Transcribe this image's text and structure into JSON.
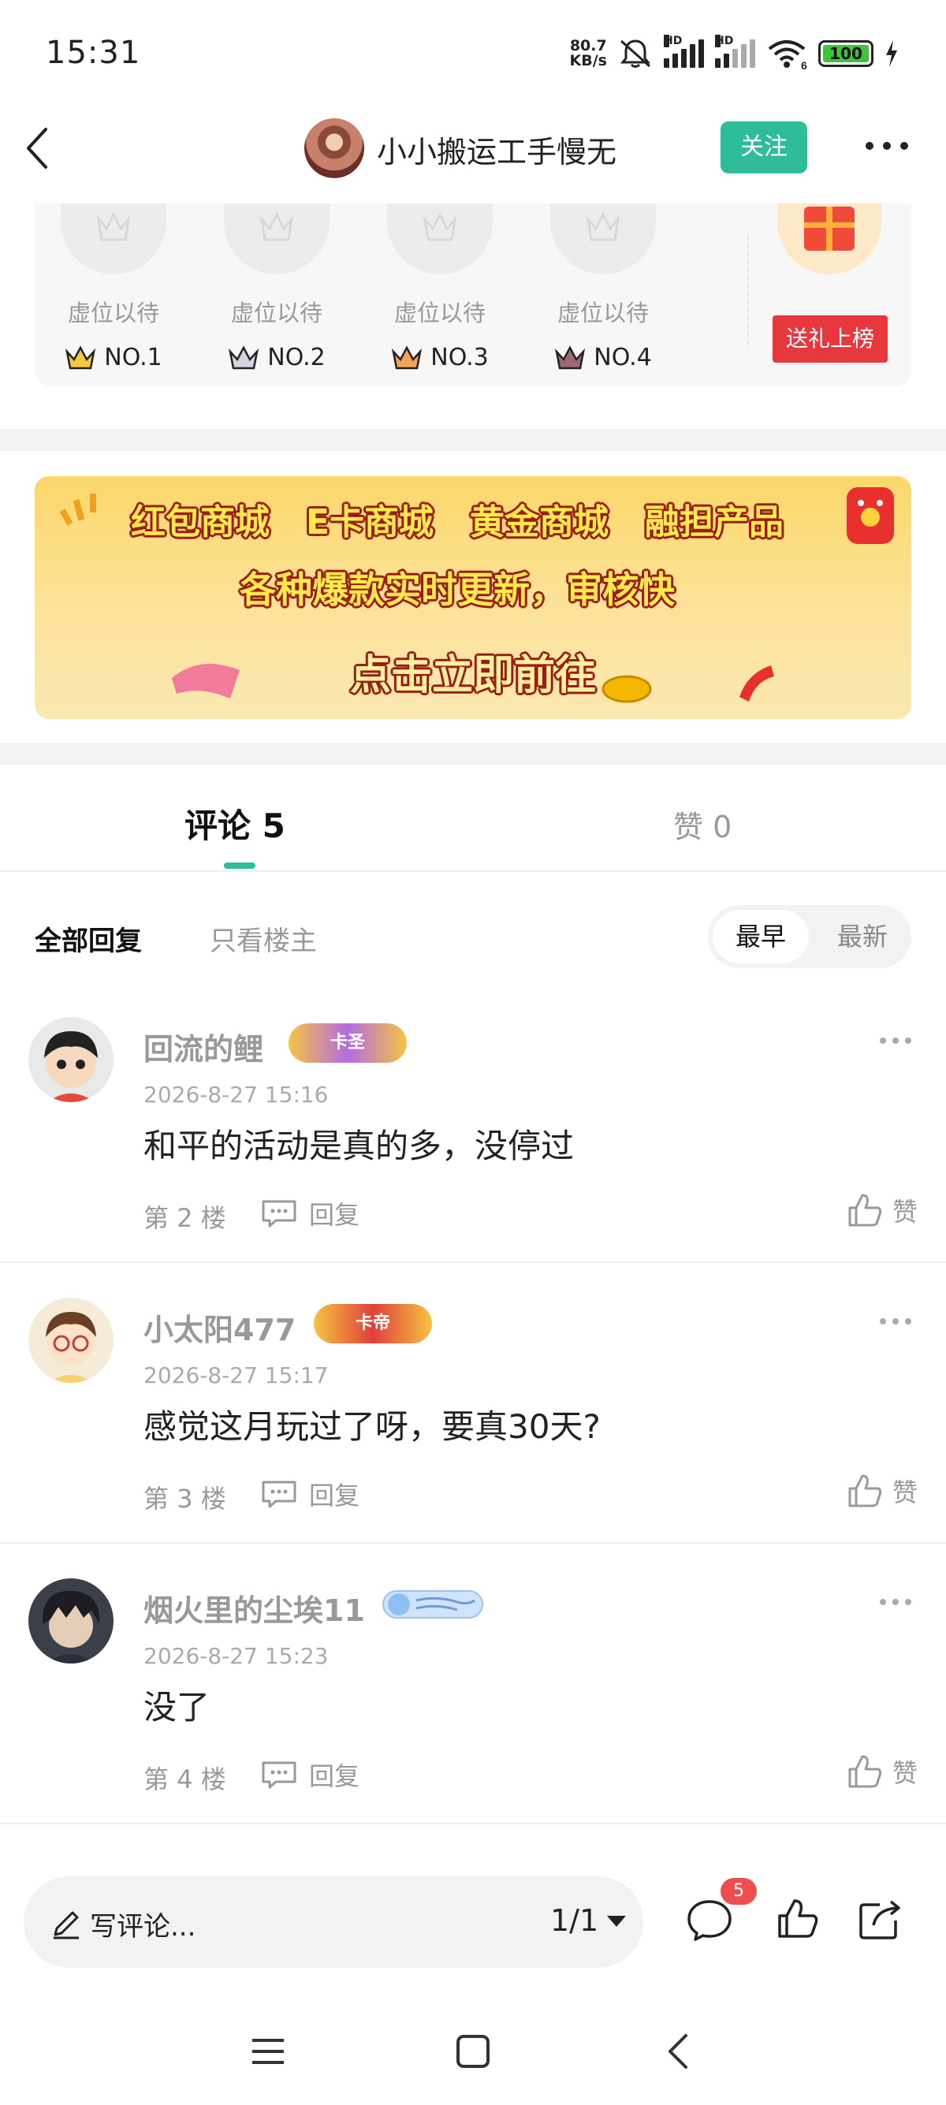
{
  "status_bar": {
    "time": "15:31",
    "net_speed_value": "80.7",
    "net_speed_unit": "KB/s",
    "hd1": "HD",
    "hd2": "HD",
    "wifi_gen": "6",
    "battery": "100"
  },
  "nav": {
    "title": "小小搬运工手慢无",
    "follow_label": "关注"
  },
  "ranking": {
    "slots": [
      {
        "label": "虚位以待",
        "rank": "NO.1",
        "crown_color": "#e9b420"
      },
      {
        "label": "虚位以待",
        "rank": "NO.2",
        "crown_color": "#b9b9c6"
      },
      {
        "label": "虚位以待",
        "rank": "NO.3",
        "crown_color": "#e08a3c"
      },
      {
        "label": "虚位以待",
        "rank": "NO.4",
        "crown_color": "#8a5a66"
      }
    ],
    "gift_button": "送礼上榜"
  },
  "banner": {
    "items": [
      "红包商城",
      "E卡商城",
      "黄金商城",
      "融担产品"
    ],
    "subtitle": "各种爆款实时更新，审核快",
    "cta": "点击立即前往"
  },
  "tabs": {
    "comments_label": "评论 5",
    "likes_label": "赞 0"
  },
  "filters": {
    "all": "全部回复",
    "op_only": "只看楼主",
    "sort_earliest": "最早",
    "sort_latest": "最新"
  },
  "comments": [
    {
      "name": "回流的鲤",
      "badge": "卡圣",
      "time": "2026-8-27 15:16",
      "text": "和平的活动是真的多，没停过",
      "floor": "第 2 楼",
      "reply": "回复",
      "like": "赞"
    },
    {
      "name": "小太阳477",
      "badge": "卡帝",
      "time": "2026-8-27 15:17",
      "text": "感觉这月玩过了呀，要真30天?",
      "floor": "第 3 楼",
      "reply": "回复",
      "like": "赞"
    },
    {
      "name": "烟火里的尘埃11",
      "badge": "",
      "time": "2026-8-27 15:23",
      "text": "没了",
      "floor": "第 4 楼",
      "reply": "回复",
      "like": "赞"
    }
  ],
  "bottom": {
    "input_placeholder": "写评论...",
    "page": "1/1",
    "comment_badge": "5"
  },
  "colors": {
    "accent": "#2ebc9a",
    "gift_red": "#e8383d",
    "badge_red": "#f04e4e"
  }
}
